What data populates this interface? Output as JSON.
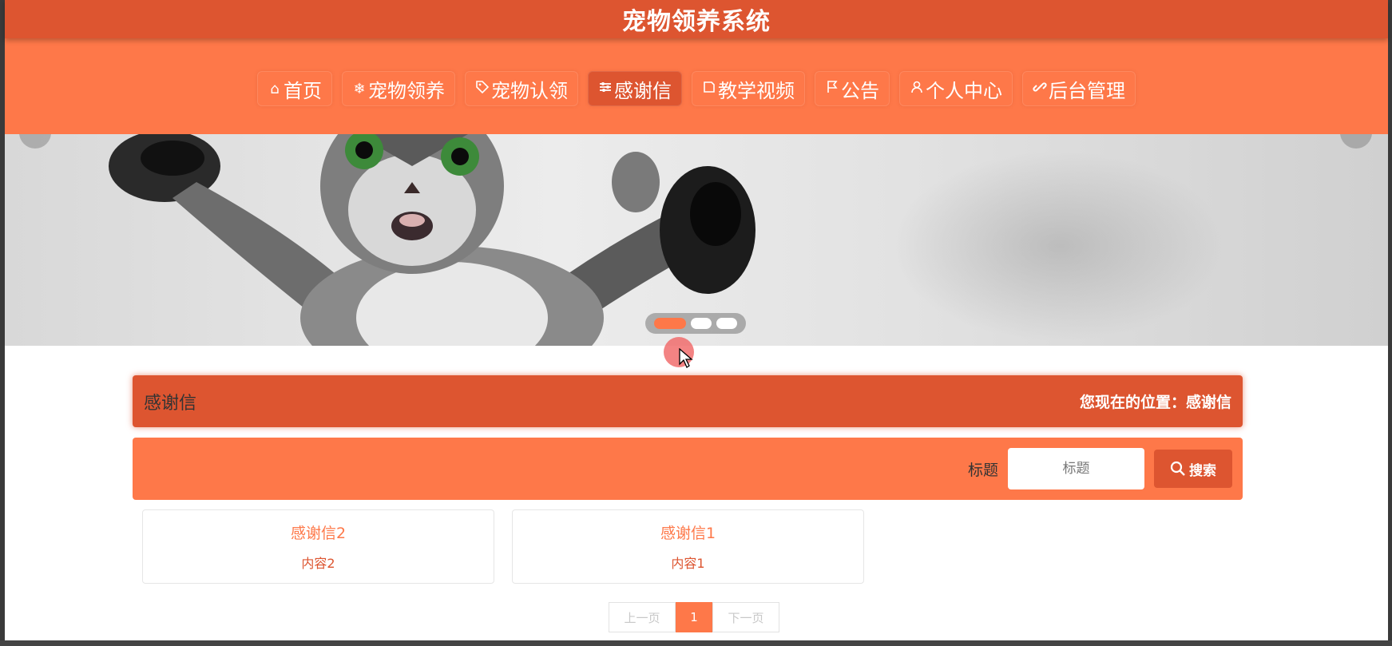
{
  "app": {
    "title": "宠物领养系统"
  },
  "nav": {
    "items": [
      {
        "icon": "home-icon",
        "label": "首页",
        "active": false
      },
      {
        "icon": "snowflake-icon",
        "label": "宠物领养",
        "active": false
      },
      {
        "icon": "tag-icon",
        "label": "宠物认领",
        "active": false
      },
      {
        "icon": "sliders-icon",
        "label": "感谢信",
        "active": true
      },
      {
        "icon": "video-icon",
        "label": "教学视频",
        "active": false
      },
      {
        "icon": "flag-icon",
        "label": "公告",
        "active": false
      },
      {
        "icon": "user-icon",
        "label": "个人中心",
        "active": false
      },
      {
        "icon": "link-icon",
        "label": "后台管理",
        "active": false
      }
    ]
  },
  "banner": {
    "slide_count": 3,
    "active_slide": 1
  },
  "section": {
    "title": "感谢信",
    "breadcrumb": "您现在的位置：感谢信"
  },
  "search": {
    "label": "标题",
    "placeholder": "标题",
    "value": "",
    "button_label": "搜索"
  },
  "cards": [
    {
      "title": "感谢信2",
      "content": "内容2"
    },
    {
      "title": "感谢信1",
      "content": "内容1"
    }
  ],
  "pagination": {
    "prev": "上一页",
    "current": "1",
    "next": "下一页"
  },
  "colors": {
    "primary": "#fe7849",
    "dark": "#dd5530"
  }
}
